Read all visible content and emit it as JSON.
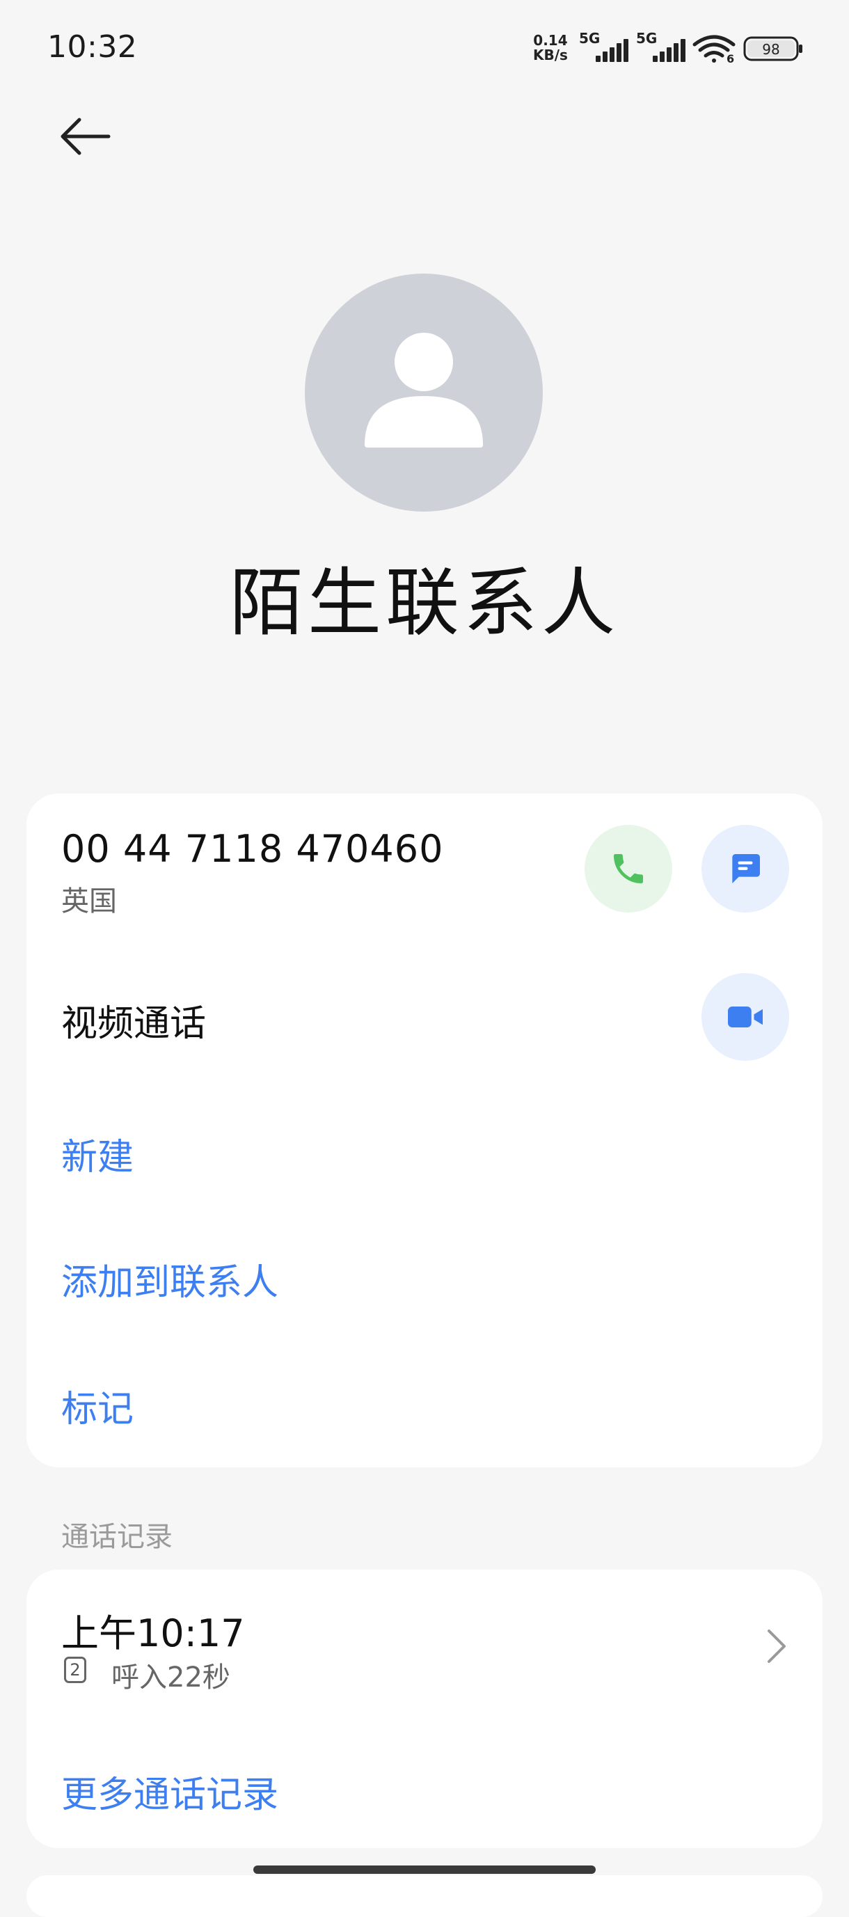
{
  "status_bar": {
    "time": "10:32",
    "net_speed_value": "0.14",
    "net_speed_unit": "KB/s",
    "sim1_network": "5G",
    "sim2_network": "5G",
    "wifi_badge": "6",
    "battery": "98"
  },
  "header": {
    "back_icon": "arrow-left-icon"
  },
  "contact": {
    "avatar_icon": "person-icon",
    "name": "陌生联系人"
  },
  "phone": {
    "number": "00 44 7118 470460",
    "region": "英国",
    "call_icon": "phone-icon",
    "message_icon": "message-icon"
  },
  "video": {
    "label": "视频通话",
    "icon": "video-camera-icon"
  },
  "actions": {
    "new": "新建",
    "add_to_contacts": "添加到联系人",
    "mark": "标记"
  },
  "call_log": {
    "section_title": "通话记录",
    "entries": [
      {
        "time": "上午10:17",
        "sim": "2",
        "detail": "呼入22秒"
      }
    ],
    "more_link": "更多通话记录"
  },
  "colors": {
    "accent_blue": "#3d7ff0",
    "call_green": "#4fc15f",
    "background": "#f6f6f6",
    "card": "#ffffff",
    "avatar_bg": "#cfd1d8"
  }
}
